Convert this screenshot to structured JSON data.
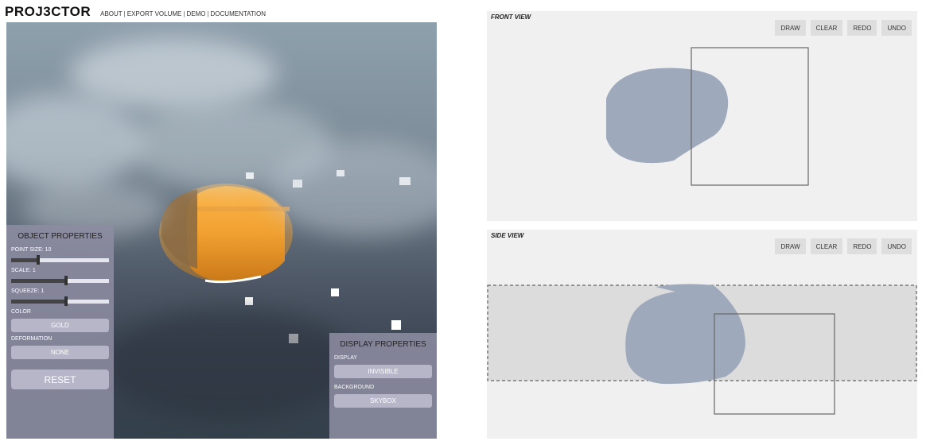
{
  "header": {
    "logo": "PROJ3CTOR",
    "nav": [
      "ABOUT",
      "EXPORT VOLUME",
      "DEMO",
      "DOCUMENTATION"
    ],
    "separator": "|"
  },
  "object_properties": {
    "title": "OBJECT PROPERTIES",
    "point_size_label": "POINT SIZE: 10",
    "point_size_level": 0.28,
    "scale_label": "SCALE: 1",
    "scale_level": 0.56,
    "squeeze_label": "SQUEEZE: 1",
    "squeeze_level": 0.56,
    "color_label": "COLOR",
    "color_value": "GOLD",
    "deformation_label": "DEFORMATION",
    "deformation_value": "NONE",
    "reset_label": "RESET"
  },
  "display_properties": {
    "title": "DISPLAY PROPERTIES",
    "display_label": "DISPLAY",
    "display_value": "INVISIBLE",
    "background_label": "BACKGROUND",
    "background_value": "SKYBOX"
  },
  "front_view": {
    "title": "FRONT VIEW",
    "buttons": [
      "DRAW",
      "CLEAR",
      "REDO",
      "UNDO"
    ]
  },
  "side_view": {
    "title": "SIDE VIEW",
    "buttons": [
      "DRAW",
      "CLEAR",
      "REDO",
      "UNDO"
    ]
  },
  "colors": {
    "panel_bg": "#8c8ca0",
    "shape_fill": "#9eaabb",
    "gold": "#f0a030"
  }
}
